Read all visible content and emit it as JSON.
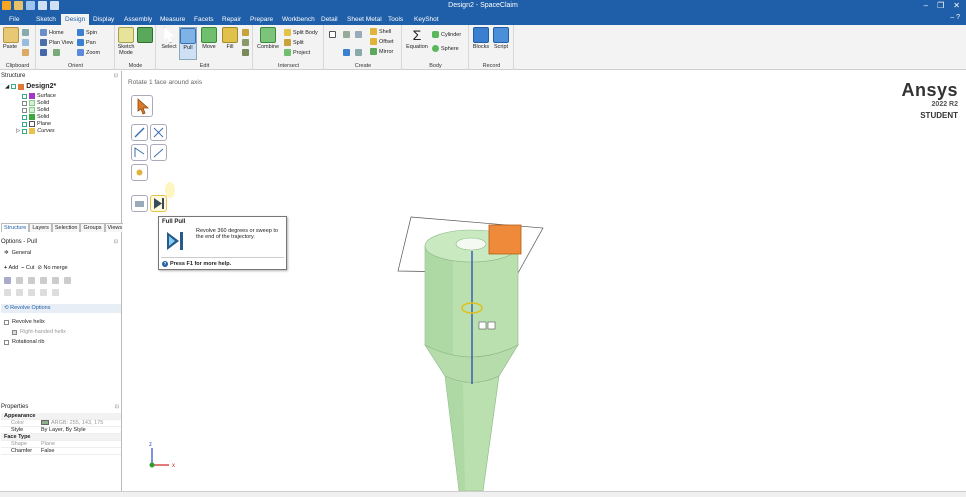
{
  "window": {
    "title": "Design2 - SpaceClaim",
    "controls": [
      "–",
      "❐",
      "✕"
    ]
  },
  "menu": {
    "tabs": [
      "File",
      "Sketch",
      "Design",
      "Display",
      "Assembly",
      "Measure",
      "Facets",
      "Repair",
      "Prepare",
      "Workbench",
      "Detail",
      "Sheet Metal",
      "Tools",
      "KeyShot"
    ],
    "active": "Design",
    "help": "– ?"
  },
  "ribbon": {
    "clipboard": {
      "name": "Clipboard",
      "paste": "Paste"
    },
    "orient": {
      "name": "Orient",
      "home": "Home",
      "spin": "Spin",
      "plan_view": "Plan View",
      "pan": "Pan",
      "zoom": "Zoom"
    },
    "mode": {
      "name": "Mode",
      "sketch_mode": "Sketch Mode"
    },
    "edit": {
      "name": "Edit",
      "select": "Select",
      "pull": "Pull",
      "move": "Move",
      "fill": "Fill"
    },
    "intersect": {
      "name": "Intersect",
      "combine": "Combine",
      "split_body": "Split Body",
      "split": "Split",
      "project": "Project"
    },
    "create": {
      "name": "Create",
      "shell": "Shell",
      "offset": "Offset",
      "mirror": "Mirror"
    },
    "body": {
      "name": "Body",
      "equation": "Equation",
      "cylinder": "Cylinder",
      "sphere": "Sphere"
    },
    "record": {
      "name": "Record",
      "blocks": "Blocks",
      "script": "Script"
    }
  },
  "structure": {
    "header": "Structure",
    "root": "Design2*",
    "items": [
      "Surface",
      "Solid",
      "Solid",
      "Solid",
      "Plane",
      "Curves"
    ]
  },
  "panel_tabs": [
    "Structure",
    "Layers",
    "Selection",
    "Groups",
    "Views"
  ],
  "options": {
    "header": "Options - Pull",
    "general": "General",
    "add": "Add",
    "cut": "Cut",
    "no_merge": "No merge",
    "revolve_options": "Revolve Options",
    "revolve_helix": "Revolve helix",
    "right_handed_helix": "Right-handed helix",
    "rotational_rib": "Rotational rib"
  },
  "properties": {
    "header": "Properties",
    "rows": [
      {
        "k": "Appearance",
        "v": "",
        "cat": true
      },
      {
        "k": "Color",
        "v": "ARGB: 255, 143, 175",
        "cat": false
      },
      {
        "k": "Style",
        "v": "By Layer, By Style",
        "cat": false
      },
      {
        "k": "Face Type",
        "v": "",
        "cat": true
      },
      {
        "k": "Shape",
        "v": "Plane",
        "cat": false
      },
      {
        "k": "Chamfer",
        "v": "False",
        "cat": false
      }
    ]
  },
  "viewport": {
    "hint": "Rotate 1 face around axis",
    "brand": "Ansys",
    "version": "2022 R2",
    "edition": "STUDENT",
    "axis_z": "z",
    "axis_x": "x"
  },
  "tooltip": {
    "title": "Full Pull",
    "desc": "Revolve 360 degrees or sweep to the end of the trajectory.",
    "help": "Press F1 for more help."
  },
  "colors": {
    "accent": "#1f5ea8",
    "model": "#b9e0ae",
    "model_edge": "#5d8a55",
    "orange": "#f08a3b"
  }
}
